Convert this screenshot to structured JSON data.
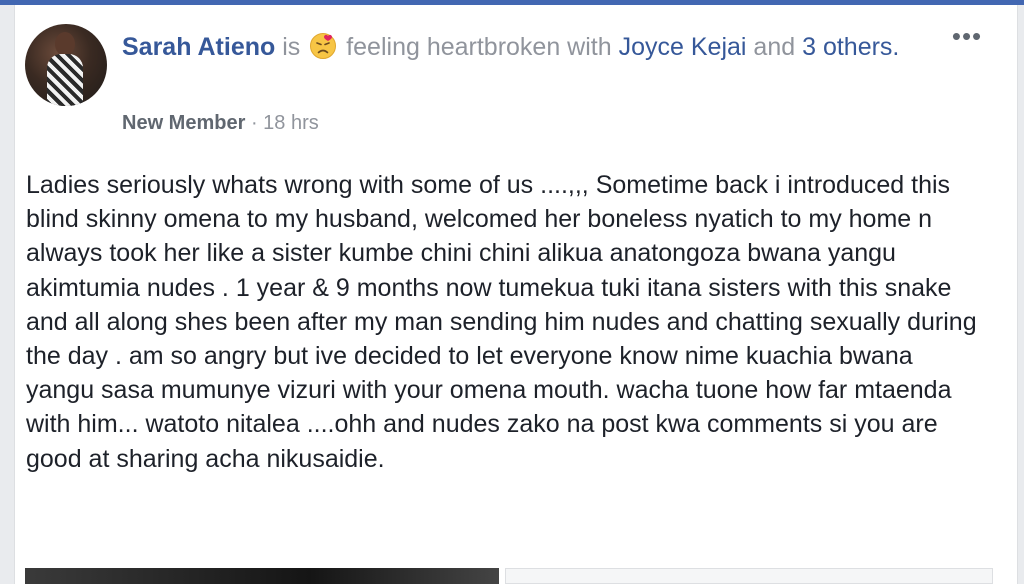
{
  "post": {
    "author": "Sarah Atieno",
    "is_word": "is",
    "feeling_icon": "heartbroken-face-emoji",
    "feeling_text": "feeling heartbroken with",
    "tagged_person": "Joyce Kejai",
    "and_word": "and",
    "others_link": "3 others.",
    "badge": "New Member",
    "separator": "·",
    "time": "18 hrs",
    "menu_icon": "more-options-icon",
    "body": "Ladies seriously whats wrong with some of us ....,,, Sometime back i introduced this blind skinny omena to my husband, welcomed her boneless nyatich to my home n always took her like a sister kumbe chini chini alikua anatongoza bwana yangu akimtumia nudes . 1 year & 9 months now tumekua tuki itana sisters with this snake and all along shes been after my man sending him nudes and chatting sexually during the day . am so angry but ive decided to let everyone know nime kuachia bwana yangu sasa mumunye vizuri with your omena mouth. wacha tuone how far mtaenda with him... watoto nitalea ....ohh and nudes zako na post kwa comments si you are good at sharing acha nikusaidie."
  },
  "colors": {
    "link": "#365899",
    "meta": "#90949c",
    "text": "#1d2129",
    "accent_bar": "#4267b2",
    "background": "#e9ebee"
  }
}
